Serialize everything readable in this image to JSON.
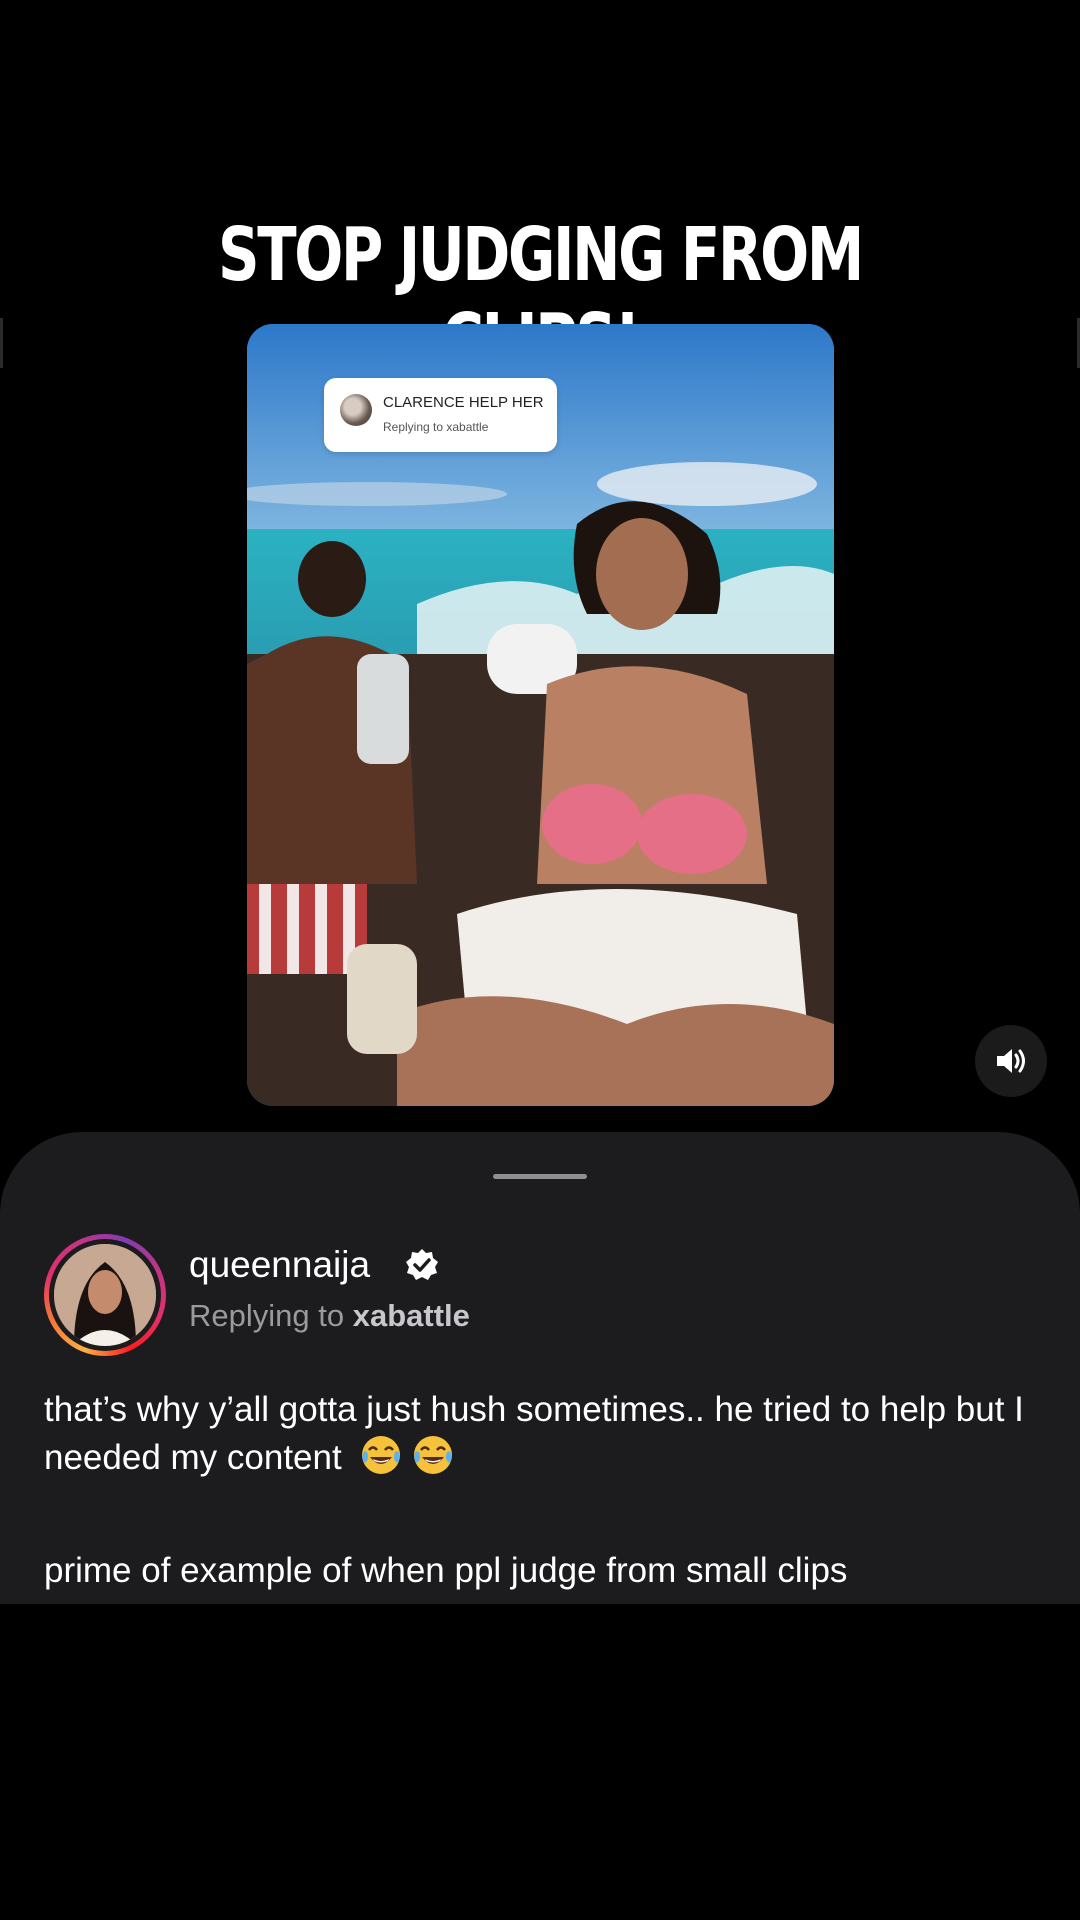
{
  "headline": "STOP JUDGING FROM CLIPS!",
  "video": {
    "reply_sticker": {
      "title": "CLARENCE HELP HER",
      "subtitle": "Replying to xabattle"
    },
    "mute_icon": "speaker-volume-icon"
  },
  "comment_sheet": {
    "username": "queennaija",
    "verified_icon": "verified-badge-icon",
    "replying_prefix": "Replying to",
    "replying_handle": "xabattle",
    "comment_text": "that’s why y’all gotta just hush sometimes.. he tried to help but I needed my content",
    "comment_emojis": [
      "face-with-tears-of-joy-icon",
      "face-with-tears-of-joy-icon"
    ],
    "comment_text_2": "prime of example of when ppl judge from small clips"
  },
  "colors": {
    "background": "#000000",
    "sheet": "#1c1c1e",
    "secondary_text": "#9a9a9e"
  }
}
